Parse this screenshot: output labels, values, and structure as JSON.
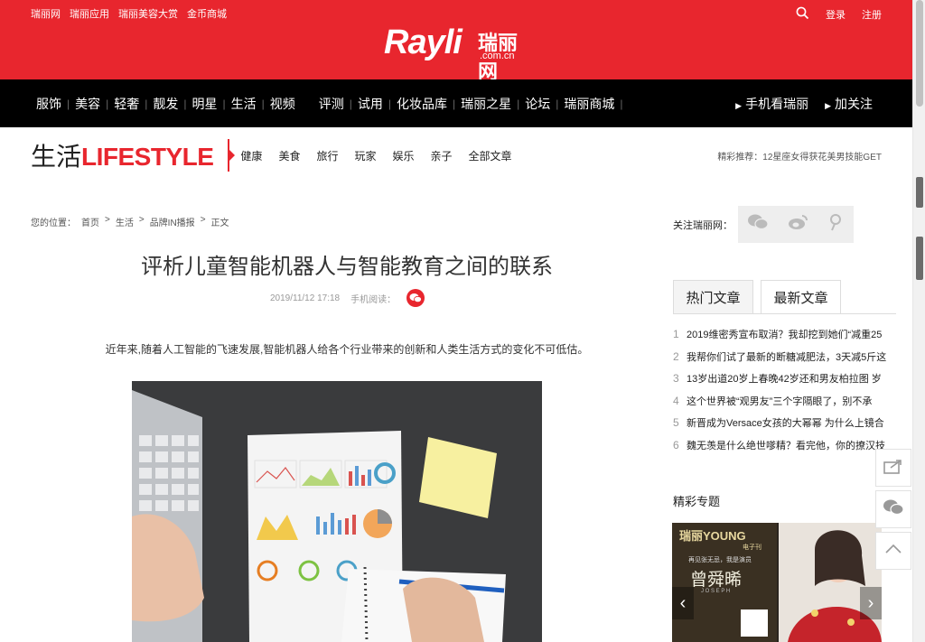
{
  "top": {
    "links": [
      "瑞丽网",
      "瑞丽应用",
      "瑞丽美容大赏",
      "金币商城"
    ],
    "login": "登录",
    "register": "注册"
  },
  "logo": {
    "brand": "Rayli",
    "cn": "瑞丽网",
    "domain": ".com.cn"
  },
  "nav": {
    "items": [
      "服饰",
      "美容",
      "轻奢",
      "靓发",
      "明星",
      "生活",
      "视频",
      "评测",
      "试用",
      "化妆品库",
      "瑞丽之星",
      "论坛",
      "瑞丽商城"
    ],
    "mobile": "手机看瑞丽",
    "follow": "加关注"
  },
  "section": {
    "title_cn": "生活",
    "title_en": "LIFESTYLE",
    "subnav": [
      "健康",
      "美食",
      "旅行",
      "玩家",
      "娱乐",
      "亲子",
      "全部文章"
    ],
    "recommend": "精彩推荐：12星座女得获花美男技能GET"
  },
  "breadcrumb": [
    "您的位置：",
    "首页",
    ">",
    "生活",
    ">",
    "品牌IN播报",
    ">",
    "正文"
  ],
  "article": {
    "title": "评析儿童智能机器人与智能教育之间的联系",
    "date": "2019/11/12 17:18",
    "mobile_read": "手机阅读：",
    "lead": "近年来,随着人工智能的飞速发展,智能机器人给各个行业带来的创新和人类生活方式的变化不可低估。"
  },
  "sidebar": {
    "follow_label": "关注瑞丽网：",
    "tabs": [
      "热门文章",
      "最新文章"
    ],
    "hot": [
      {
        "num": "1",
        "text": "2019维密秀宣布取消？我却挖到她们“减重25"
      },
      {
        "num": "2",
        "text": "我帮你们试了最新的断糖减肥法，3天减5斤这"
      },
      {
        "num": "3",
        "text": "13岁出道20岁上春晚42岁还和男友柏拉图 岁"
      },
      {
        "num": "4",
        "text": "这个世界被“观男友”三个字隔眼了，别不承"
      },
      {
        "num": "5",
        "text": "新晋成为Versace女孩的大幂幂 为什么上镜合"
      },
      {
        "num": "6",
        "text": "魏无羡是什么绝世嗲精？看完他，你的撩汉技"
      }
    ],
    "special_title": "精彩专题",
    "special": {
      "brand": "瑞丽YOUNG",
      "sub": "电子刊",
      "line1": "再见张无忌，我是演员",
      "name": "曾舜晞",
      "name_en": "J O S E P H"
    }
  },
  "colors": {
    "brand_red": "#e8262e",
    "nav_black": "#000000"
  },
  "icons": [
    "search-icon",
    "wechat-icon",
    "weibo-icon",
    "pin-icon",
    "share-icon",
    "chevron-up-icon",
    "chevron-left-icon",
    "chevron-right-icon"
  ]
}
